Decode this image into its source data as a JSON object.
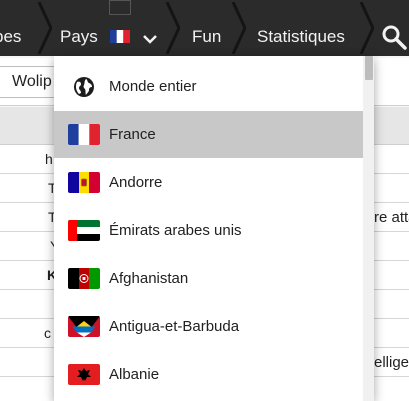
{
  "navbar": {
    "items": [
      {
        "label": "bes"
      },
      {
        "label": "Pays"
      },
      {
        "label": "Fun"
      },
      {
        "label": "Statistiques"
      }
    ],
    "selected_country_flag": "France"
  },
  "subbar": {
    "chip_label": "Wolip"
  },
  "background_rows": [
    {
      "text": "h"
    },
    {
      "text": "T"
    },
    {
      "text": "T",
      "right": "re atta"
    },
    {
      "text": "Y"
    },
    {
      "text": "K"
    },
    {
      "text": ""
    },
    {
      "text": "c"
    },
    {
      "text": "",
      "right": "elligen"
    },
    {
      "text": ""
    }
  ],
  "dropdown": {
    "items": [
      {
        "label": "Monde entier",
        "icon": "globe-icon",
        "selected": false
      },
      {
        "label": "France",
        "icon": "flag-france",
        "selected": true
      },
      {
        "label": "Andorre",
        "icon": "flag-andorra",
        "selected": false
      },
      {
        "label": "Émirats arabes unis",
        "icon": "flag-uae",
        "selected": false
      },
      {
        "label": "Afghanistan",
        "icon": "flag-afghanistan",
        "selected": false
      },
      {
        "label": "Antigua-et-Barbuda",
        "icon": "flag-antigua",
        "selected": false
      },
      {
        "label": "Albanie",
        "icon": "flag-albania",
        "selected": false
      }
    ]
  },
  "colors": {
    "navbar_bg": "#2b2b2b",
    "navbar_text": "#f2f2f2",
    "selected_item_bg": "#c8c8c8"
  }
}
